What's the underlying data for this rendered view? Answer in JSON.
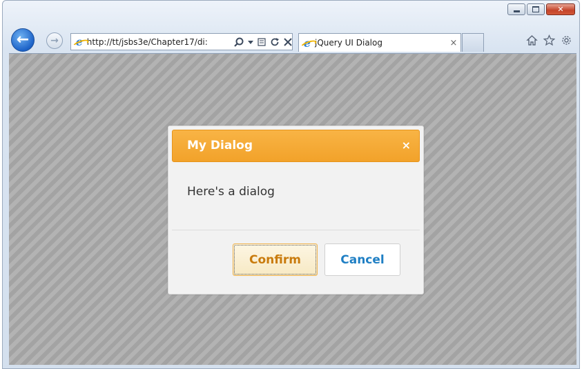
{
  "browser": {
    "url": "http://tt/jsbs3e/Chapter17/di:",
    "tab_title": "jQuery UI Dialog",
    "tab_close": "×",
    "back_glyph": "←",
    "forward_glyph": "→",
    "address_icons": [
      "search-icon",
      "dropdown-icon",
      "compat-icon",
      "refresh-icon",
      "stop-icon"
    ],
    "tool_icons": [
      "home-icon",
      "favorites-icon",
      "settings-icon"
    ]
  },
  "window_controls": {
    "close_glyph": "✕"
  },
  "dialog": {
    "title": "My Dialog",
    "close_glyph": "×",
    "message": "Here's a dialog",
    "confirm_label": "Confirm",
    "cancel_label": "Cancel",
    "accent_color": "#f2a22a",
    "confirm_text_color": "#c97b0d",
    "cancel_text_color": "#1f7fc4"
  }
}
